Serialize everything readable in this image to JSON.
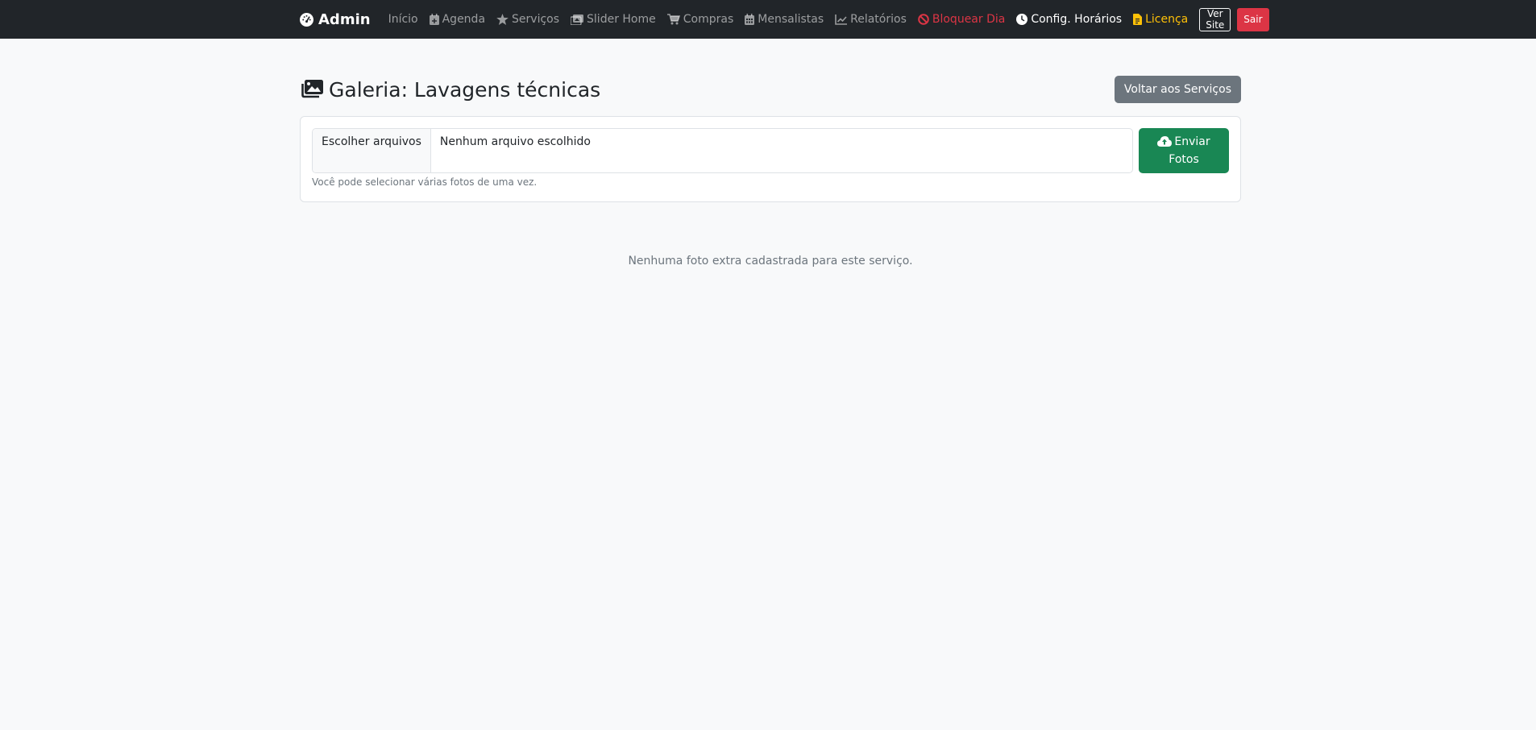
{
  "navbar": {
    "brand": "Admin",
    "links": [
      {
        "label": "Início",
        "icon": "none"
      },
      {
        "label": "Agenda",
        "icon": "calendar-plus-icon"
      },
      {
        "label": "Serviços",
        "icon": "star-icon"
      },
      {
        "label": "Slider Home",
        "icon": "images-icon"
      },
      {
        "label": "Compras",
        "icon": "cart-icon"
      },
      {
        "label": "Mensalistas",
        "icon": "calendar-days-icon"
      },
      {
        "label": "Relatórios",
        "icon": "chart-line-icon"
      },
      {
        "label": "Bloquear Dia",
        "icon": "ban-icon"
      },
      {
        "label": "Config. Horários",
        "icon": "clock-icon"
      },
      {
        "label": "Licença",
        "icon": "file-icon"
      }
    ],
    "view_site": "Ver Site",
    "logout": "Sair"
  },
  "page": {
    "title": "Galeria: Lavagens técnicas",
    "back_button": "Voltar aos Serviços"
  },
  "upload": {
    "choose_files": "Escolher arquivos",
    "no_file": "Nenhum arquivo escolhido",
    "send_line1": "Enviar",
    "send_line2": "Fotos",
    "help": "Você pode selecionar várias fotos de uma vez."
  },
  "empty_message": "Nenhuma foto extra cadastrada para este serviço.",
  "colors": {
    "navbar_bg": "#212529",
    "danger": "#dc3545",
    "warning": "#ffc107",
    "success": "#198754",
    "secondary": "#6c757d"
  }
}
